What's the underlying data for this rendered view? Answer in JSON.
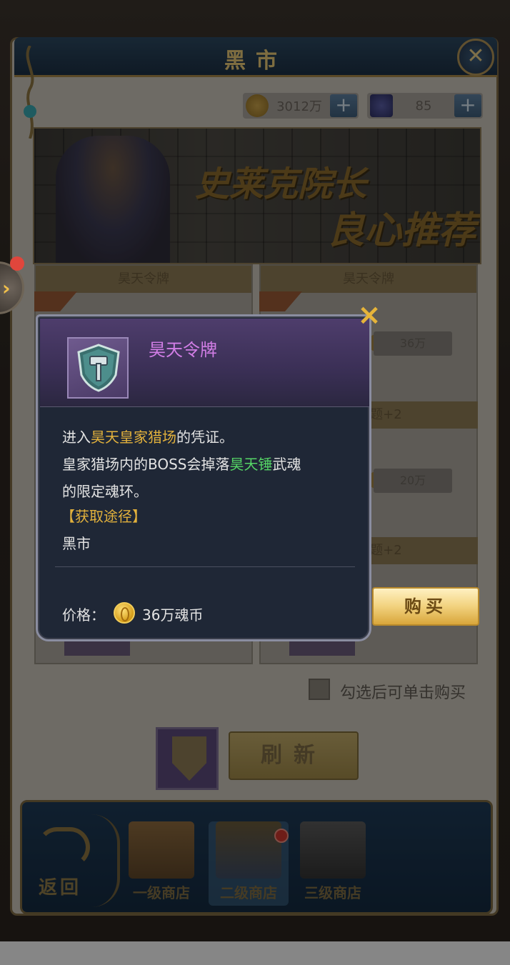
{
  "window": {
    "title": "黑市"
  },
  "currency": [
    {
      "icon": "gold-coin-icon",
      "value": "3012万"
    },
    {
      "icon": "diamond-icon",
      "value": "85"
    }
  ],
  "banner": {
    "line1": "史莱克院长",
    "line2": "良心推荐"
  },
  "cards": [
    {
      "header": "昊天令牌",
      "price": ""
    },
    {
      "header": "昊天令牌",
      "price": "36万"
    }
  ],
  "side_rows": [
    {
      "label": "1 主题+2",
      "price": "20万"
    },
    {
      "label": "1 主题+2"
    }
  ],
  "checkbox": {
    "label": "勾选后可单击购买"
  },
  "refresh": {
    "label": "刷新"
  },
  "bottom_nav": {
    "back_label": "返回",
    "tabs": [
      {
        "label": "一级商店"
      },
      {
        "label": "二级商店",
        "active": true
      },
      {
        "label": "三级商店"
      }
    ]
  },
  "popup": {
    "item_name": "昊天令牌",
    "desc": {
      "l1_a": "进入",
      "l1_b": "昊天皇家猎场",
      "l1_c": "的凭证。",
      "l2_a": "皇家猎场内的BOSS会掉落",
      "l2_b": "昊天锤",
      "l2_c": "武魂",
      "l3": "的限定魂环。"
    },
    "source_title": "【获取途径】",
    "source_value": "黑市",
    "price_label": "价格：",
    "price_value": "36万魂币",
    "close_icon": "×"
  },
  "buy_button": {
    "label": "购买"
  },
  "colors": {
    "item_name": "#d27ee6",
    "highlight_gold": "#e2b13c",
    "highlight_green": "#55d466"
  }
}
